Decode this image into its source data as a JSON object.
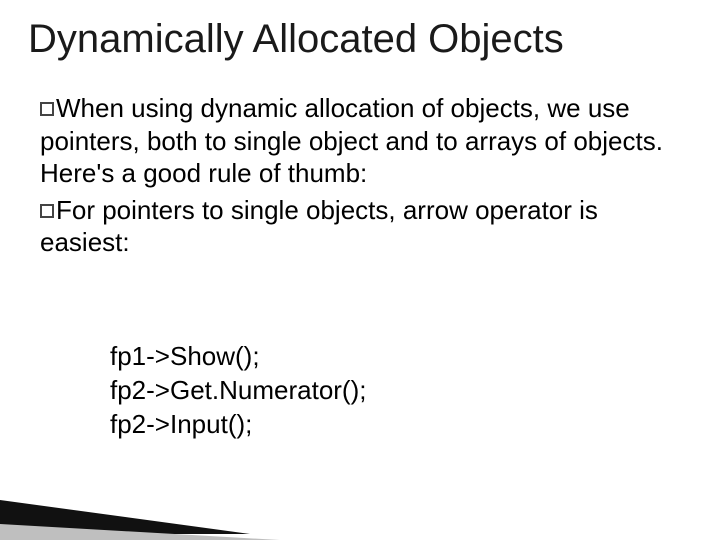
{
  "title": "Dynamically Allocated Objects",
  "bullets": [
    "When using dynamic allocation of objects, we use pointers, both to single object and to arrays of objects. Here's a good rule of thumb:",
    "For pointers to single objects, arrow operator is easiest:"
  ],
  "code": {
    "line1": "fp1->Show();",
    "line2": "fp2->Get.Numerator();",
    "line3": "fp2->Input();"
  }
}
